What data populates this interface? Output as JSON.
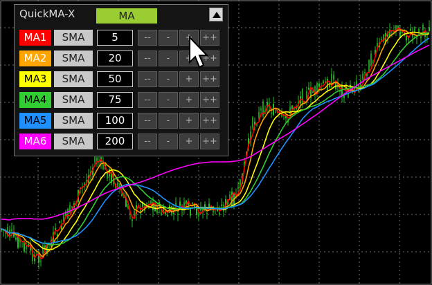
{
  "panel": {
    "title": "QuickMA-X",
    "mode_button": "MA",
    "collapse_icon": "triangle-up-icon",
    "step_labels": {
      "dec_big": "--",
      "dec": "-",
      "inc": "+",
      "inc_big": "++"
    },
    "rows": [
      {
        "label": "MA1",
        "color": "#ff0000",
        "text_color": "#ffffff",
        "type": "SMA",
        "period": "5"
      },
      {
        "label": "MA2",
        "color": "#ffa500",
        "text_color": "#ffffff",
        "type": "SMA",
        "period": "20"
      },
      {
        "label": "MA3",
        "color": "#ffff00",
        "text_color": "#000000",
        "type": "SMA",
        "period": "50"
      },
      {
        "label": "MA4",
        "color": "#32cd32",
        "text_color": "#000000",
        "type": "SMA",
        "period": "75"
      },
      {
        "label": "MA5",
        "color": "#1e90ff",
        "text_color": "#000000",
        "type": "SMA",
        "period": "100"
      },
      {
        "label": "MA6",
        "color": "#ff00ff",
        "text_color": "#ffffff",
        "type": "SMA",
        "period": "200"
      }
    ]
  },
  "chart": {
    "background": "#000000",
    "grid_color": "#c0c0c0",
    "candle_color": "#22c022",
    "candle_down_color": "#1a9a1a",
    "ma_colors": [
      "#ff0000",
      "#ffa500",
      "#ffff00",
      "#32cd32",
      "#1e90ff",
      "#ff00ff"
    ]
  },
  "cursor_icon": "mouse-pointer-icon"
}
